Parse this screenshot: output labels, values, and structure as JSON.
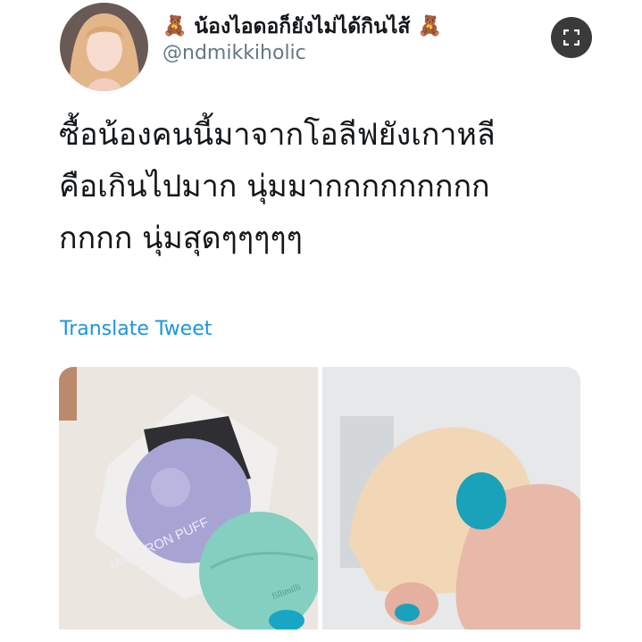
{
  "tweet": {
    "display_name": "น้องไอดอก็ยังไม่ได้กินไส้",
    "handle": "@ndmikkiholic",
    "text": "ซื้อน้องคนนี้มาจากโอลีฟยังเกาหลี\nคือเกินไปมาก นุ่มมากกกกกกกกก\nกกกก นุ่มสุดๆๆๆๆๆ",
    "translate_label": "Translate Tweet",
    "name_emoji": "🧸"
  },
  "media": {
    "left_photo_product_text": "MACARON PUFF",
    "left_photo_brand": "fillimilli"
  },
  "icons": {
    "expand": "expand-icon"
  },
  "colors": {
    "link": "#1b95e0",
    "text": "#14171a",
    "secondary": "#657786"
  }
}
